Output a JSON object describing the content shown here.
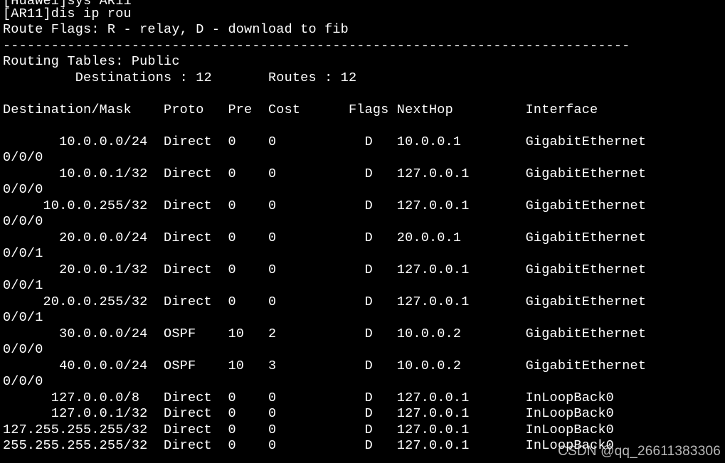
{
  "terminal": {
    "lines": [
      "[Huawei]sys AR11",
      "[AR11]dis ip rou",
      "Route Flags: R - relay, D - download to fib",
      "------------------------------------------------------------------------------",
      "Routing Tables: Public",
      "         Destinations : 12       Routes : 12",
      "",
      "Destination/Mask    Proto   Pre  Cost      Flags NextHop         Interface",
      "",
      "       10.0.0.0/24  Direct  0    0           D   10.0.0.1        GigabitEthernet",
      "0/0/0",
      "       10.0.0.1/32  Direct  0    0           D   127.0.0.1       GigabitEthernet",
      "0/0/0",
      "     10.0.0.255/32  Direct  0    0           D   127.0.0.1       GigabitEthernet",
      "0/0/0",
      "       20.0.0.0/24  Direct  0    0           D   20.0.0.1        GigabitEthernet",
      "0/0/1",
      "       20.0.0.1/32  Direct  0    0           D   127.0.0.1       GigabitEthernet",
      "0/0/1",
      "     20.0.0.255/32  Direct  0    0           D   127.0.0.1       GigabitEthernet",
      "0/0/1",
      "       30.0.0.0/24  OSPF    10   2           D   10.0.0.2        GigabitEthernet",
      "0/0/0",
      "       40.0.0.0/24  OSPF    10   3           D   10.0.0.2        GigabitEthernet",
      "0/0/0",
      "      127.0.0.0/8   Direct  0    0           D   127.0.0.1       InLoopBack0",
      "      127.0.0.1/32  Direct  0    0           D   127.0.0.1       InLoopBack0",
      "127.255.255.255/32  Direct  0    0           D   127.0.0.1       InLoopBack0",
      "255.255.255.255/32  Direct  0    0           D   127.0.0.1       InLoopBack0"
    ]
  },
  "watermark": {
    "text": "CSDN @qq_26611383306"
  },
  "colors": {
    "background": "#000000",
    "text": "#ffffff"
  }
}
